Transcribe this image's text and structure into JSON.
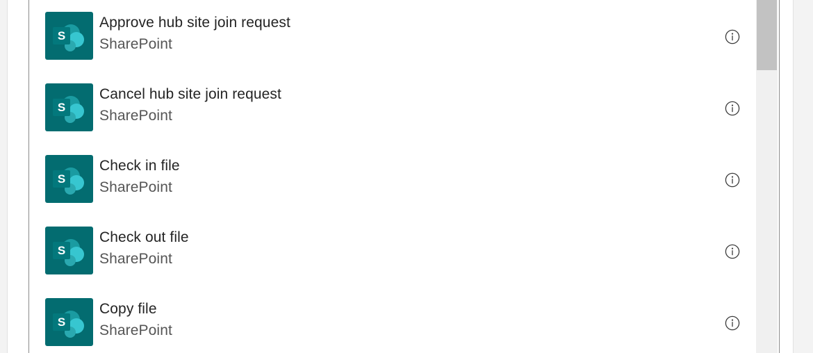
{
  "actions": [
    {
      "title": "Approve hub site join request",
      "connector": "SharePoint",
      "icon": "sharepoint-logo-icon"
    },
    {
      "title": "Cancel hub site join request",
      "connector": "SharePoint",
      "icon": "sharepoint-logo-icon"
    },
    {
      "title": "Check in file",
      "connector": "SharePoint",
      "icon": "sharepoint-logo-icon"
    },
    {
      "title": "Check out file",
      "connector": "SharePoint",
      "icon": "sharepoint-logo-icon"
    },
    {
      "title": "Copy file",
      "connector": "SharePoint",
      "icon": "sharepoint-logo-icon"
    }
  ],
  "info_icon": "info-icon",
  "colors": {
    "sharepoint_tile": "#036c70",
    "sharepoint_circle_dark": "#1a9ba1",
    "sharepoint_circle_light": "#37c6d0",
    "title_text": "#242424",
    "subtitle_text": "#555555"
  },
  "sharepoint_letter": "S"
}
